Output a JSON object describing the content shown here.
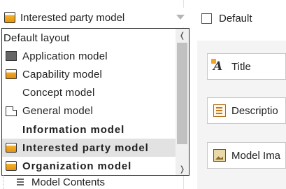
{
  "combo": {
    "selected_label": "Interested party model",
    "selected_icon": "folder-icon"
  },
  "dropdown": {
    "header": "Default layout",
    "items": [
      {
        "label": "Application model",
        "icon": "application-model-icon",
        "bold": false,
        "selected": false
      },
      {
        "label": "Capability model",
        "icon": "capability-model-icon",
        "bold": false,
        "selected": false
      },
      {
        "label": "Concept model",
        "icon": "",
        "bold": false,
        "selected": false
      },
      {
        "label": "General model",
        "icon": "document-icon",
        "bold": false,
        "selected": false
      },
      {
        "label": "Information model",
        "icon": "",
        "bold": true,
        "selected": false
      },
      {
        "label": "Interested party model",
        "icon": "folder-icon",
        "bold": true,
        "selected": true
      },
      {
        "label": "Organization model",
        "icon": "folder-icon",
        "bold": true,
        "selected": false
      }
    ]
  },
  "tree": {
    "model_contents_label": "Model Contents"
  },
  "default_checkbox": {
    "label": "Default",
    "checked": false
  },
  "fields": {
    "title_label": "Title",
    "description_label": "Descriptio",
    "model_image_label": "Model Ima"
  },
  "colors": {
    "selected_row": "#e2e2e2",
    "folder_orange": "#f3b22c",
    "border": "#2b2b2b"
  }
}
